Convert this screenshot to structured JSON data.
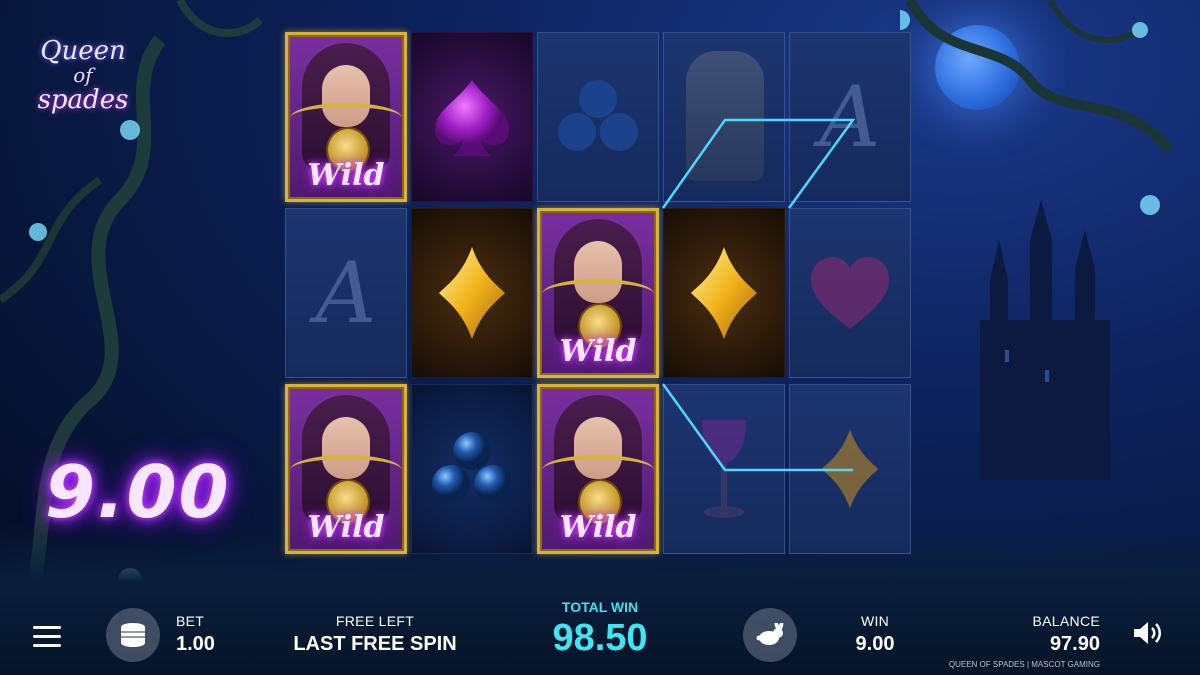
{
  "game": {
    "logo_line1": "Queen",
    "logo_line2": "of",
    "logo_line3": "spades",
    "footer": "QUEEN OF SPADES | MASCOT GAMING"
  },
  "big_win": "9.00",
  "reels": [
    [
      "wild",
      "spade",
      "clubs",
      "king"
    ],
    [
      "ace",
      "diamond",
      "wild",
      "diamond"
    ],
    [
      "wild",
      "clubs",
      "wild",
      "goblet"
    ]
  ],
  "extra_column": [
    "ace",
    "heart",
    "diamond"
  ],
  "wild_label": "Wild",
  "bottom_bar": {
    "bet_label": "BET",
    "bet_value": "1.00",
    "free_left_label": "FREE LEFT",
    "free_left_value": "LAST FREE SPIN",
    "total_win_label": "TOTAL WIN",
    "total_win_value": "98.50",
    "win_label": "WIN",
    "win_value": "9.00",
    "balance_label": "BALANCE",
    "balance_value": "97.90"
  },
  "colors": {
    "accent": "#3fe6f2",
    "wild_glow": "#e04cff",
    "gold": "#d8b23a"
  },
  "icons": {
    "menu": "hamburger-menu-icon",
    "coins": "coin-stack-icon",
    "turbo": "rabbit-icon",
    "sound": "speaker-icon"
  }
}
